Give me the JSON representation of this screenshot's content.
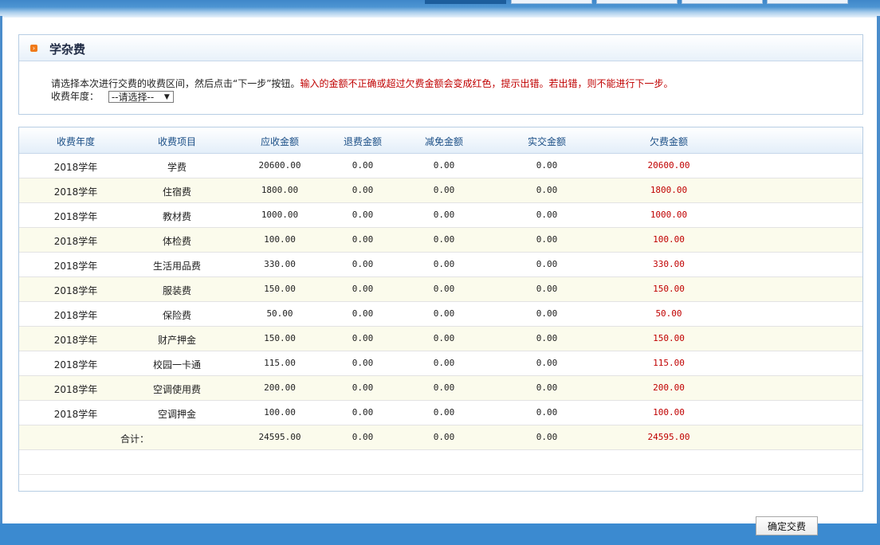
{
  "section": {
    "title": "学杂费",
    "instruction_prefix": "请选择本次进行交费的收费区间，然后点击“下一步”按钮。",
    "instruction_warning": "输入的金额不正确或超过欠费金额会变成红色，提示出错。若出错，则不能进行下一步。",
    "year_label": "收费年度：",
    "year_select_value": "--请选择--"
  },
  "table": {
    "headers": [
      "收费年度",
      "收费项目",
      "应收金额",
      "退费金额",
      "减免金额",
      "实交金额",
      "欠费金额"
    ],
    "rows": [
      [
        "2018学年",
        "学费",
        "20600.00",
        "0.00",
        "0.00",
        "0.00",
        "20600.00"
      ],
      [
        "2018学年",
        "住宿费",
        "1800.00",
        "0.00",
        "0.00",
        "0.00",
        "1800.00"
      ],
      [
        "2018学年",
        "教材费",
        "1000.00",
        "0.00",
        "0.00",
        "0.00",
        "1000.00"
      ],
      [
        "2018学年",
        "体检费",
        "100.00",
        "0.00",
        "0.00",
        "0.00",
        "100.00"
      ],
      [
        "2018学年",
        "生活用品费",
        "330.00",
        "0.00",
        "0.00",
        "0.00",
        "330.00"
      ],
      [
        "2018学年",
        "服装费",
        "150.00",
        "0.00",
        "0.00",
        "0.00",
        "150.00"
      ],
      [
        "2018学年",
        "保险费",
        "50.00",
        "0.00",
        "0.00",
        "0.00",
        "50.00"
      ],
      [
        "2018学年",
        "财产押金",
        "150.00",
        "0.00",
        "0.00",
        "0.00",
        "150.00"
      ],
      [
        "2018学年",
        "校园一卡通",
        "115.00",
        "0.00",
        "0.00",
        "0.00",
        "115.00"
      ],
      [
        "2018学年",
        "空调使用费",
        "200.00",
        "0.00",
        "0.00",
        "0.00",
        "200.00"
      ],
      [
        "2018学年",
        "空调押金",
        "100.00",
        "0.00",
        "0.00",
        "0.00",
        "100.00"
      ]
    ],
    "total": {
      "label": "合计：",
      "receivable": "24595.00",
      "refund": "0.00",
      "reduction": "0.00",
      "paid": "0.00",
      "owed": "24595.00"
    }
  },
  "buttons": {
    "confirm_label": "确定交费"
  },
  "colors": {
    "accent": "#3b8ad0",
    "owed_red": "#c00000",
    "header_text": "#1a4e86",
    "alt_row": "#fbfbec"
  }
}
